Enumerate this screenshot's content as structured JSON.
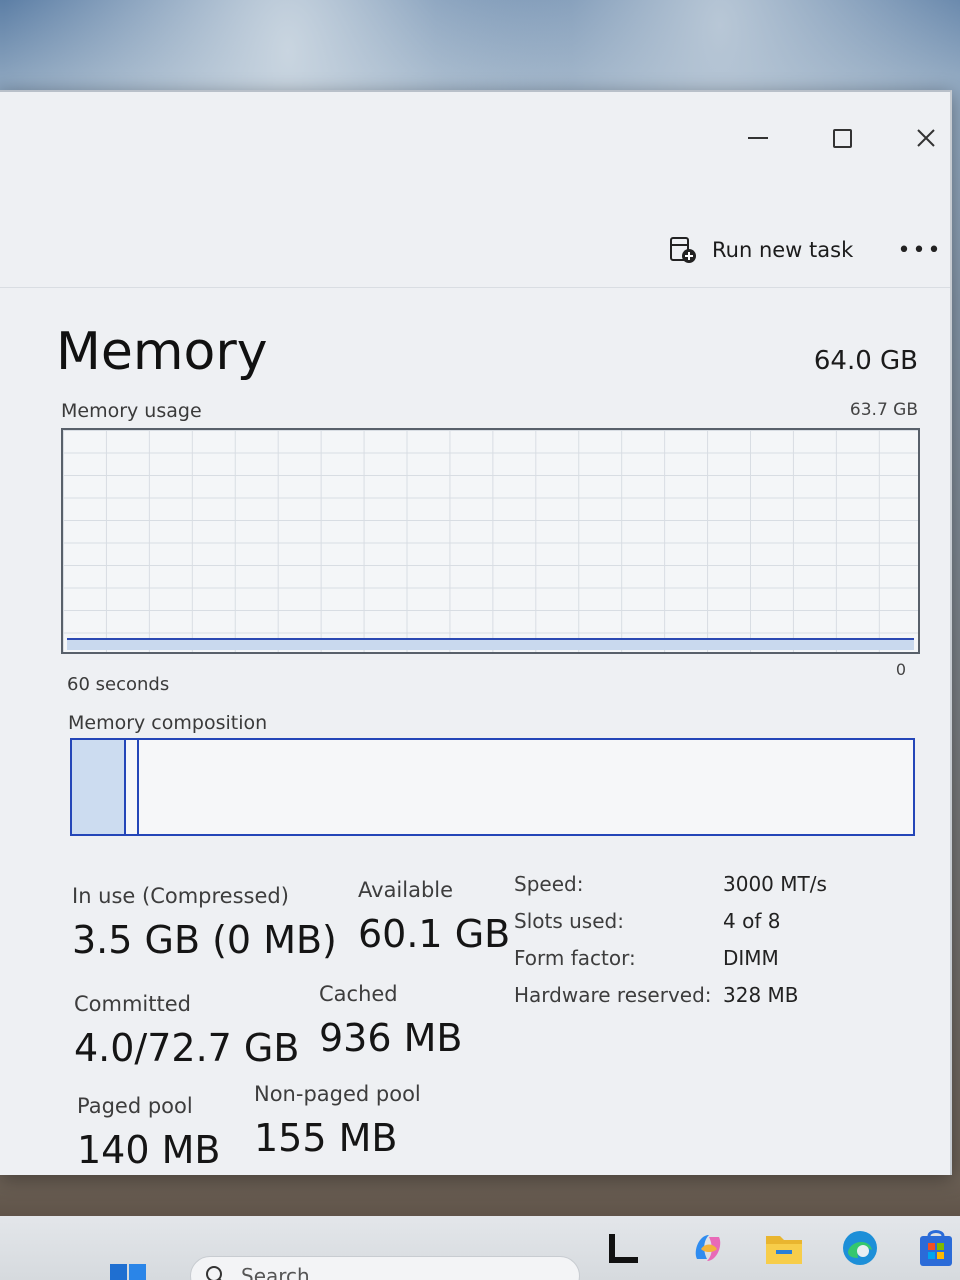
{
  "window": {
    "title_controls": [
      "minimize",
      "maximize",
      "close"
    ]
  },
  "commandbar": {
    "run_new_task_label": "Run new task",
    "more_label": "•••"
  },
  "page": {
    "title": "Memory",
    "total_capacity": "64.0 GB"
  },
  "usage_graph": {
    "label": "Memory usage",
    "max_label": "63.7 GB",
    "time_label": "60 seconds",
    "min_label": "0",
    "current_fraction": 0.055
  },
  "composition": {
    "label": "Memory composition",
    "in_use_fraction": 0.064,
    "modified_fraction": 0.015
  },
  "stats": {
    "in_use": {
      "label": "In use (Compressed)",
      "value": "3.5 GB (0 MB)"
    },
    "available": {
      "label": "Available",
      "value": "60.1 GB"
    },
    "committed": {
      "label": "Committed",
      "value": "4.0/72.7 GB"
    },
    "cached": {
      "label": "Cached",
      "value": "936 MB"
    },
    "paged_pool": {
      "label": "Paged pool",
      "value": "140 MB"
    },
    "non_paged_pool": {
      "label": "Non-paged pool",
      "value": "155 MB"
    }
  },
  "specs": {
    "speed": {
      "label": "Speed:",
      "value": "3000 MT/s"
    },
    "slots": {
      "label": "Slots used:",
      "value": "4 of 8"
    },
    "form_factor": {
      "label": "Form factor:",
      "value": "DIMM"
    },
    "hw_reserved": {
      "label": "Hardware reserved:",
      "value": "328 MB"
    }
  },
  "taskbar": {
    "search_placeholder": "Search",
    "icons": [
      "start-icon",
      "search-icon",
      "task-view-icon",
      "copilot-icon",
      "file-explorer-icon",
      "edge-icon",
      "store-icon"
    ]
  },
  "colors": {
    "accent": "#2446b8",
    "fill": "#ccdcf0",
    "window_bg": "#eef0f3"
  }
}
